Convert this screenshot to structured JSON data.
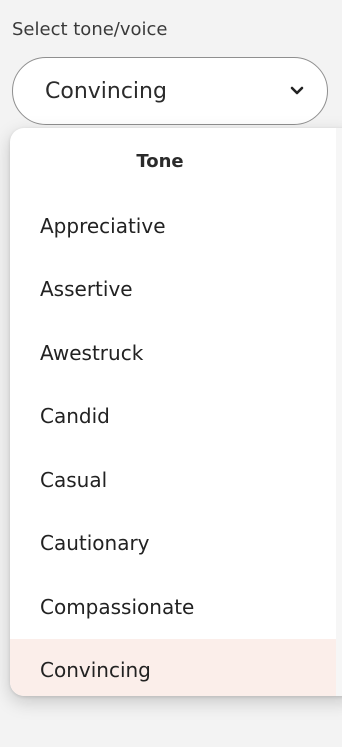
{
  "form": {
    "label": "Select tone/voice",
    "selected_value": "Convincing",
    "chevron_icon": "chevron-down-icon"
  },
  "dropdown": {
    "header": "Tone",
    "options": [
      {
        "label": "Appreciative",
        "selected": false
      },
      {
        "label": "Assertive",
        "selected": false
      },
      {
        "label": "Awestruck",
        "selected": false
      },
      {
        "label": "Candid",
        "selected": false
      },
      {
        "label": "Casual",
        "selected": false
      },
      {
        "label": "Cautionary",
        "selected": false
      },
      {
        "label": "Compassionate",
        "selected": false
      },
      {
        "label": "Convincing",
        "selected": true
      }
    ]
  },
  "colors": {
    "selected_option_bg": "#fbeeea",
    "border": "#8f8f8f"
  }
}
